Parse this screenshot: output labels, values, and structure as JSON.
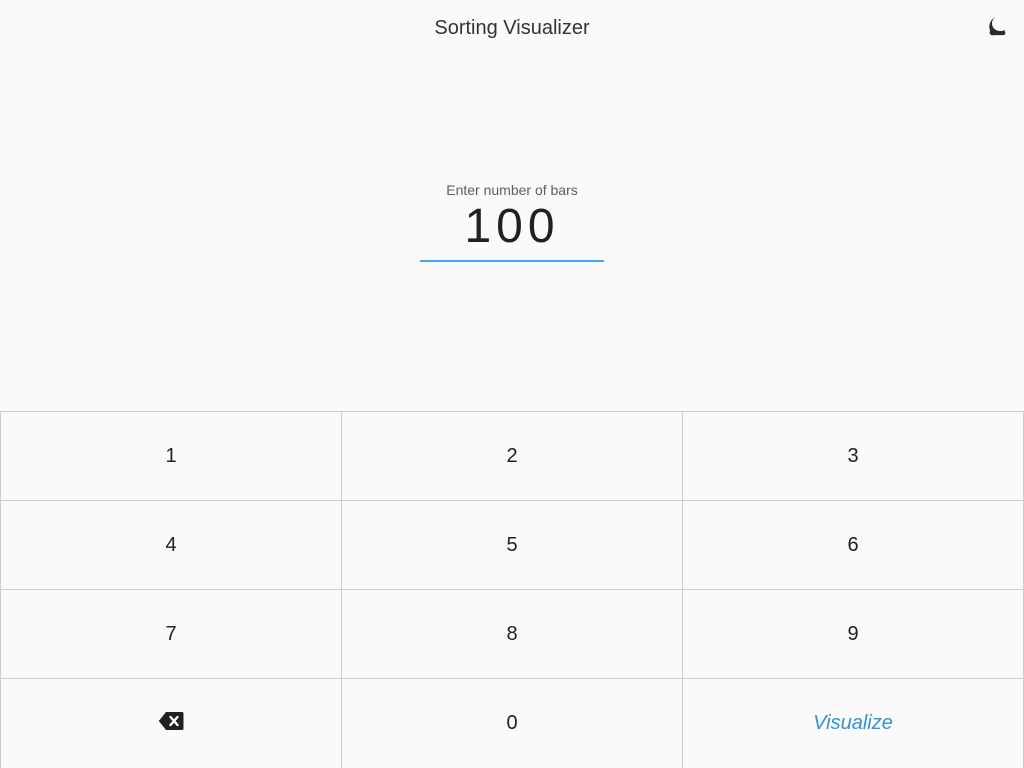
{
  "header": {
    "title": "Sorting Visualizer",
    "theme_icon": "moon-icon"
  },
  "input": {
    "label": "Enter number of bars",
    "value": "100"
  },
  "keypad": {
    "keys": [
      "1",
      "2",
      "3",
      "4",
      "5",
      "6",
      "7",
      "8",
      "9"
    ],
    "backspace_icon": "backspace-icon",
    "zero": "0",
    "visualize": "Visualize"
  },
  "colors": {
    "accent": "#42a5f5",
    "visualize_text": "#2e93d8",
    "background": "#fafafa"
  }
}
